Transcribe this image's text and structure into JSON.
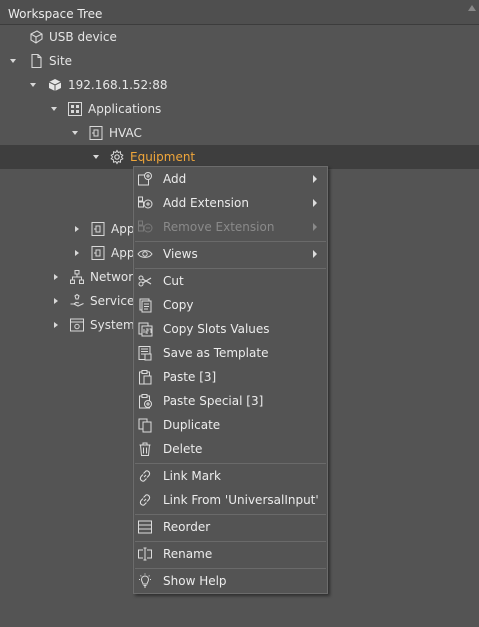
{
  "panel": {
    "title": "Workspace Tree"
  },
  "tree": {
    "usb_device": "USB device",
    "site": "Site",
    "ip": "192.168.1.52:88",
    "applications": "Applications",
    "hvac": "HVAC",
    "equipment": "Equipment",
    "app_partial_1": "App",
    "app_partial_2": "App",
    "networks_partial": "Network",
    "services_partial": "Services",
    "system_partial": "System"
  },
  "menu": {
    "add": "Add",
    "add_extension": "Add Extension",
    "remove_extension": "Remove Extension",
    "views": "Views",
    "cut": "Cut",
    "copy": "Copy",
    "copy_slots_values": "Copy Slots Values",
    "save_as_template": "Save as Template",
    "paste": "Paste [3]",
    "paste_special": "Paste Special [3]",
    "duplicate": "Duplicate",
    "delete": "Delete",
    "link_mark": "Link Mark",
    "link_from": "Link From 'UniversalInput'",
    "reorder": "Reorder",
    "rename": "Rename",
    "show_help": "Show Help"
  },
  "colors": {
    "background": "#545454",
    "selected_row": "#3e3e3e",
    "highlight_text": "#f0a63a",
    "text": "#e6e6e6",
    "disabled_text": "#8a8a8a"
  }
}
